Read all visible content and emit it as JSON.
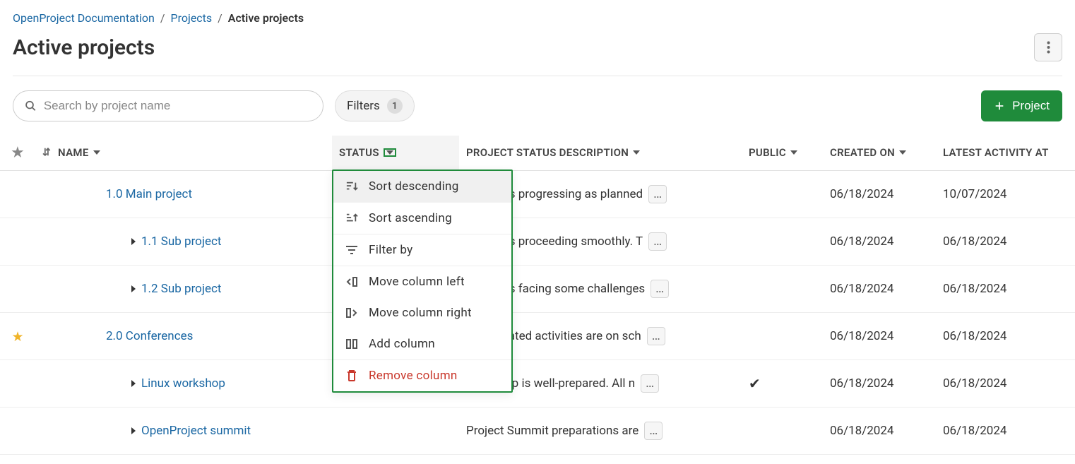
{
  "breadcrumb": {
    "root": "OpenProject Documentation",
    "section": "Projects",
    "current": "Active projects"
  },
  "page": {
    "title": "Active projects"
  },
  "toolbar": {
    "search_placeholder": "Search by project name",
    "filters_label": "Filters",
    "filters_count": "1",
    "new_project_label": "Project"
  },
  "columns": {
    "name": "NAME",
    "status": "STATUS",
    "desc": "PROJECT STATUS DESCRIPTION",
    "public": "PUBLIC",
    "created": "CREATED ON",
    "activity": "LATEST ACTIVITY AT"
  },
  "dropdown": {
    "sort_desc": "Sort descending",
    "sort_asc": "Sort ascending",
    "filter_by": "Filter by",
    "move_left": "Move column left",
    "move_right": "Move column right",
    "add_col": "Add column",
    "remove_col": "Remove column"
  },
  "rows": [
    {
      "favorite": false,
      "indent": 1,
      "expand": false,
      "name": "1.0 Main project",
      "desc": "project is progressing as planned",
      "public": false,
      "created": "06/18/2024",
      "activity": "10/07/2024"
    },
    {
      "favorite": false,
      "indent": 2,
      "expand": true,
      "name": "1.1 Sub project",
      "desc": "project is proceeding smoothly. T",
      "public": false,
      "created": "06/18/2024",
      "activity": "06/18/2024"
    },
    {
      "favorite": false,
      "indent": 2,
      "expand": true,
      "name": "1.2 Sub project",
      "desc": "project is facing some challenges",
      "public": false,
      "created": "06/18/2024",
      "activity": "06/18/2024"
    },
    {
      "favorite": true,
      "indent": 1,
      "expand": false,
      "name": "2.0 Conferences",
      "desc": "ence-related activities are on sch",
      "public": false,
      "created": "06/18/2024",
      "activity": "06/18/2024"
    },
    {
      "favorite": false,
      "indent": 2,
      "expand": true,
      "name": "Linux workshop",
      "desc": "workshop is well-prepared. All n",
      "public": true,
      "created": "06/18/2024",
      "activity": "06/18/2024"
    },
    {
      "favorite": false,
      "indent": 2,
      "expand": true,
      "name": "OpenProject summit",
      "desc": "Project Summit preparations are",
      "public": false,
      "created": "06/18/2024",
      "activity": "06/18/2024"
    }
  ]
}
